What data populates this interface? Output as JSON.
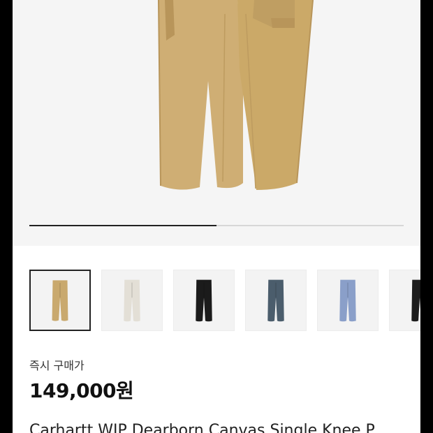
{
  "product": {
    "main_image": "khaki-canvas-pants",
    "gallery_progress": 0.5,
    "thumbnails": [
      {
        "name": "thumb-khaki",
        "color": "#c9a96e",
        "selected": true
      },
      {
        "name": "thumb-ecru",
        "color": "#e3dfd6",
        "selected": false
      },
      {
        "name": "thumb-black",
        "color": "#1b1b1b",
        "selected": false
      },
      {
        "name": "thumb-slate-blue",
        "color": "#4b5d6c",
        "selected": false
      },
      {
        "name": "thumb-light-blue",
        "color": "#8a9fc9",
        "selected": false
      },
      {
        "name": "thumb-black-2",
        "color": "#1d1d1d",
        "selected": false
      }
    ],
    "price_label": "즉시 구매가",
    "price": "149,000원",
    "title": "Carhartt WIP Dearborn Canvas Single Knee P"
  }
}
